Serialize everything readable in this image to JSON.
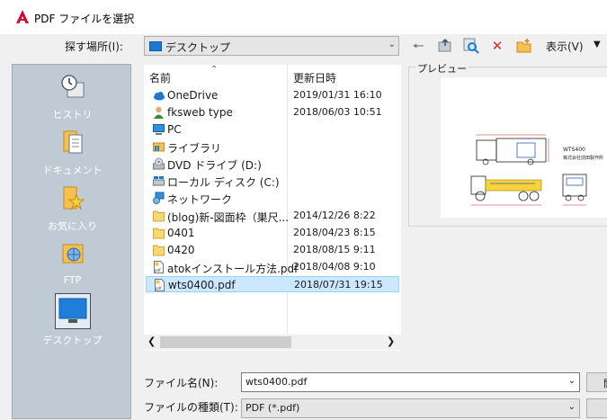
{
  "window": {
    "title": "PDF ファイルを選択"
  },
  "lookin": {
    "label": "探す場所(I):",
    "value": "デスクトップ"
  },
  "toolbar": {
    "view_label": "表示(V)"
  },
  "places": [
    {
      "label": "ヒストリ",
      "icon": "history-icon"
    },
    {
      "label": "ドキュメント",
      "icon": "documents-icon"
    },
    {
      "label": "お気に入り",
      "icon": "favorites-icon"
    },
    {
      "label": "FTP",
      "icon": "ftp-icon"
    },
    {
      "label": "デスクトップ",
      "icon": "desktop-icon",
      "selected": true
    }
  ],
  "filelist": {
    "columns": {
      "name": "名前",
      "date": "更新日時"
    },
    "rows": [
      {
        "name": "OneDrive",
        "date": "2019/01/31 16:10",
        "icon": "cloud-icon"
      },
      {
        "name": "fksweb type",
        "date": "2018/06/03 10:51",
        "icon": "user-icon"
      },
      {
        "name": "PC",
        "date": "",
        "icon": "pc-icon"
      },
      {
        "name": "ライブラリ",
        "date": "",
        "icon": "library-icon"
      },
      {
        "name": "DVD ドライブ (D:)",
        "date": "",
        "icon": "dvd-drive-icon"
      },
      {
        "name": "ローカル ディスク (C:)",
        "date": "",
        "icon": "local-disk-icon"
      },
      {
        "name": "ネットワーク",
        "date": "",
        "icon": "network-icon"
      },
      {
        "name": "(blog)新-図面枠（巣尺...",
        "date": "2014/12/26 8:22",
        "icon": "folder-icon"
      },
      {
        "name": "0401",
        "date": "2018/04/23 8:15",
        "icon": "folder-icon"
      },
      {
        "name": "0420",
        "date": "2018/08/15 9:11",
        "icon": "folder-icon"
      },
      {
        "name": "atokインストール方法.pdf",
        "date": "2018/04/08 9:10",
        "icon": "pdf-file-icon"
      },
      {
        "name": "wts0400.pdf",
        "date": "2018/07/31 19:15",
        "icon": "pdf-file-icon",
        "selected": true
      }
    ]
  },
  "preview": {
    "label": "プレビュー",
    "drawing_title": "WTS400",
    "drawing_company": "株式会社前田製作所"
  },
  "filename": {
    "label": "ファイル名(N):",
    "value": "wts0400.pdf"
  },
  "filetype": {
    "label": "ファイルの種類(T):",
    "value": "PDF (*.pdf)"
  },
  "buttons": {
    "open_label": "開"
  },
  "colors": {
    "selection": "#cce8ff",
    "places_bg": "#c0cad4",
    "accent": "#1b79d1"
  }
}
